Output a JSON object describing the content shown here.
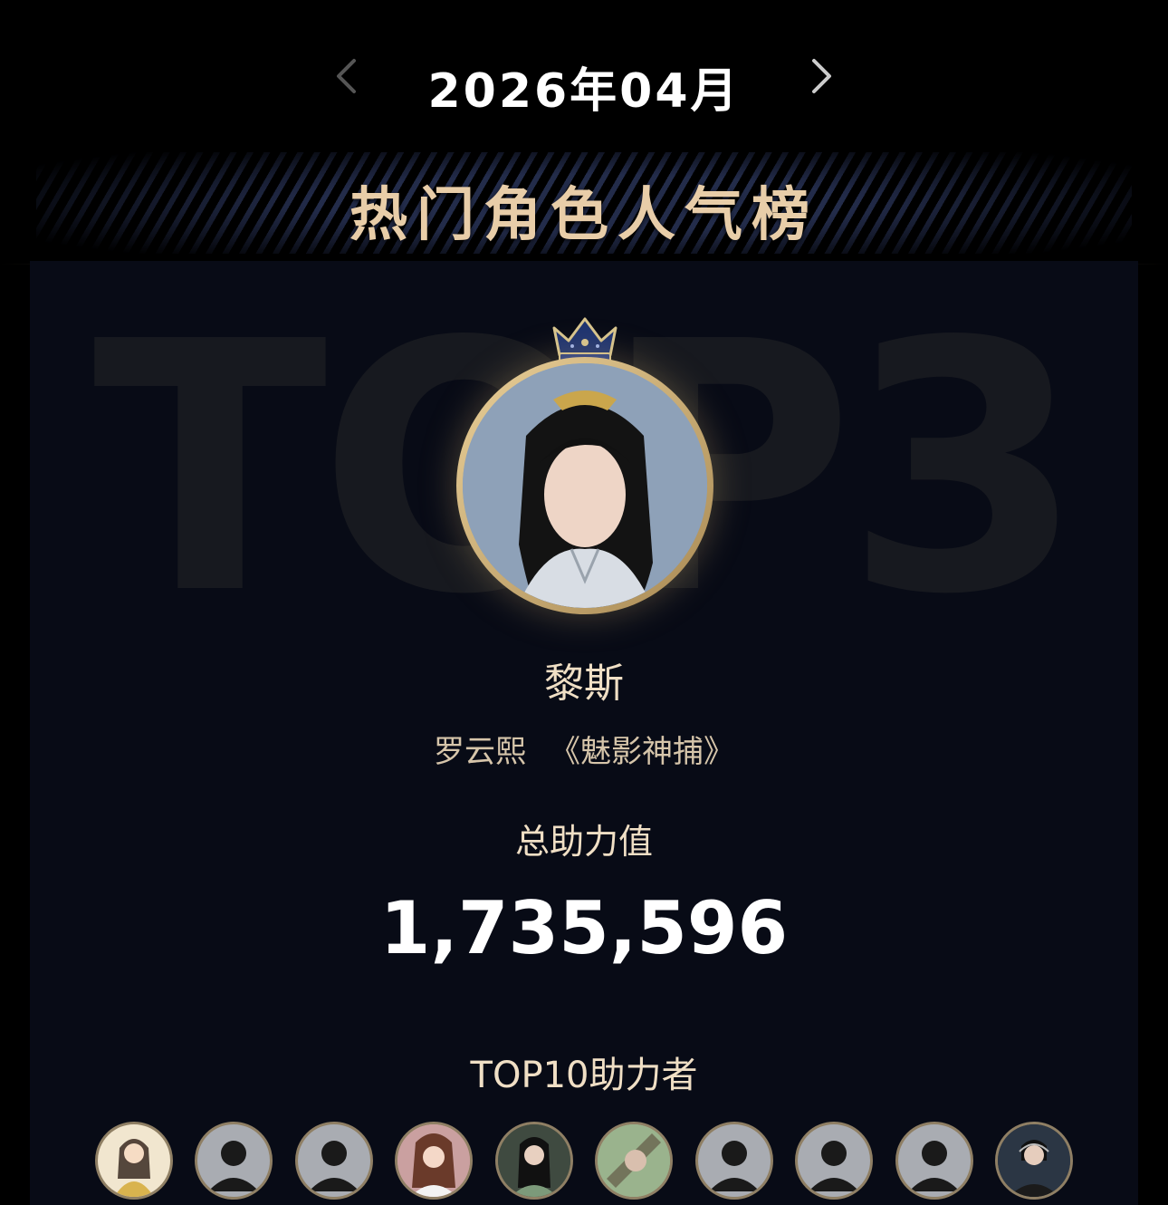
{
  "header": {
    "month": "2026年04月",
    "prev_icon": "chevron-left-icon",
    "next_icon": "chevron-right-icon"
  },
  "board": {
    "title": "热门角色人气榜",
    "watermark": "TOP3"
  },
  "character": {
    "name": "黎斯",
    "actor": "罗云熙",
    "drama": "《魅影神捕》",
    "total_label": "总助力值",
    "total_value": "1,735,596"
  },
  "supporters_section": {
    "label": "TOP10助力者",
    "avatars": [
      {
        "type": "cartoon"
      },
      {
        "type": "default-user-icon"
      },
      {
        "type": "default-user-icon"
      },
      {
        "type": "illustration"
      },
      {
        "type": "photo"
      },
      {
        "type": "photo"
      },
      {
        "type": "default-user-icon"
      },
      {
        "type": "default-user-icon"
      },
      {
        "type": "default-user-icon"
      },
      {
        "type": "photo"
      }
    ]
  },
  "colors": {
    "gold": "#e8cda8",
    "background": "#000000",
    "panel": "#080b16"
  }
}
